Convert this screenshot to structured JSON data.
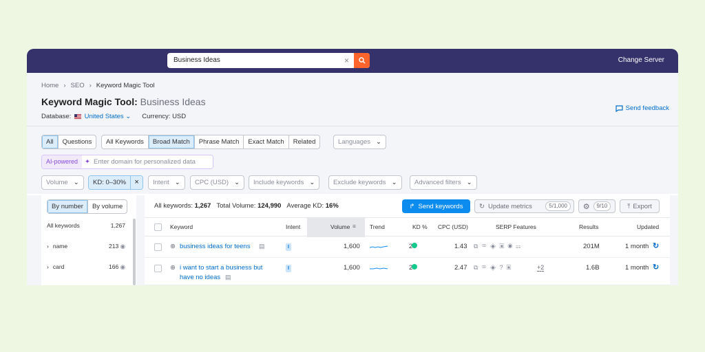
{
  "search": {
    "value": "Business Ideas",
    "clear": "×"
  },
  "topbar": {
    "change_server": "Change Server"
  },
  "breadcrumb": [
    "Home",
    "SEO",
    "Keyword Magic Tool"
  ],
  "title": {
    "tool": "Keyword Magic Tool:",
    "query": "Business Ideas"
  },
  "meta": {
    "database_label": "Database:",
    "database_value": "United States",
    "currency": "Currency: USD"
  },
  "feedback": "Send feedback",
  "match_group1": [
    "All",
    "Questions"
  ],
  "match_group2": [
    "All Keywords",
    "Broad Match",
    "Phrase Match",
    "Exact Match",
    "Related"
  ],
  "languages": "Languages",
  "ai": {
    "tag": "AI-powered",
    "placeholder": "Enter domain for personalized data"
  },
  "filter_dropdowns": {
    "volume": "Volume",
    "kd": "KD: 0–30%",
    "intent": "Intent",
    "cpc": "CPC (USD)",
    "include": "Include keywords",
    "exclude": "Exclude keywords",
    "advanced": "Advanced filters"
  },
  "left": {
    "by_number": "By number",
    "by_volume": "By volume",
    "header_label": "All keywords",
    "header_count": "1,267",
    "groups": [
      {
        "name": "name",
        "count": "213"
      },
      {
        "name": "card",
        "count": "166"
      }
    ]
  },
  "summary": {
    "all_label": "All keywords:",
    "all_value": "1,267",
    "vol_label": "Total Volume:",
    "vol_value": "124,990",
    "kd_label": "Average KD:",
    "kd_value": "16%"
  },
  "buttons": {
    "send": "Send keywords",
    "update": "Update metrics",
    "update_count": "5/1,000",
    "gear_count": "9/10",
    "export": "Export"
  },
  "columns": {
    "keyword": "Keyword",
    "intent": "Intent",
    "volume": "Volume",
    "trend": "Trend",
    "kd": "KD %",
    "cpc": "CPC (USD)",
    "serp": "SERP Features",
    "results": "Results",
    "updated": "Updated"
  },
  "rows": [
    {
      "keyword": "business ideas for teens",
      "keyword2": "",
      "intent": "I",
      "volume": "1,600",
      "kd": "26",
      "cpc": "1.43",
      "serp_extra": "",
      "results": "201M",
      "updated": "1 month"
    },
    {
      "keyword": "i want to start a business but",
      "keyword2": "have no ideas",
      "intent": "I",
      "volume": "1,600",
      "kd": "27",
      "cpc": "2.47",
      "serp_extra": "+2",
      "results": "1.6B",
      "updated": "1 month"
    }
  ],
  "colors": {
    "topbar": "#35316a",
    "accent": "#ff642d",
    "primary": "#0d8cf0",
    "kd_dot": "#16c98d",
    "background": "#eef7e1"
  }
}
